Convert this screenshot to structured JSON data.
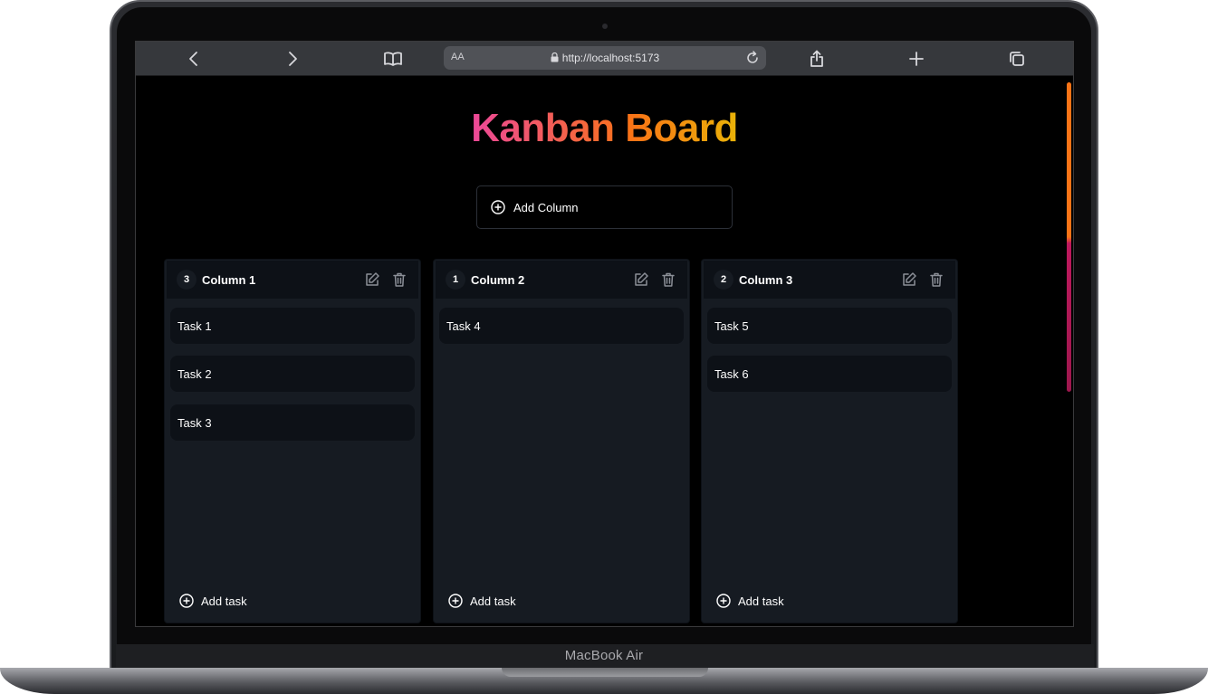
{
  "device": {
    "brand_label": "MacBook Air"
  },
  "browser": {
    "text_size_label": "AA",
    "url": "http://localhost:5173"
  },
  "page": {
    "title": "Kanban Board",
    "add_column_label": "Add Column",
    "add_task_label": "Add task",
    "title_gradient": [
      "#ec4899",
      "#f97316",
      "#eab308"
    ]
  },
  "columns": [
    {
      "title": "Column 1",
      "count": "3",
      "tasks": [
        "Task 1",
        "Task 2",
        "Task 3"
      ]
    },
    {
      "title": "Column 2",
      "count": "1",
      "tasks": [
        "Task 4"
      ]
    },
    {
      "title": "Column 3",
      "count": "2",
      "tasks": [
        "Task 5",
        "Task 6"
      ]
    }
  ]
}
